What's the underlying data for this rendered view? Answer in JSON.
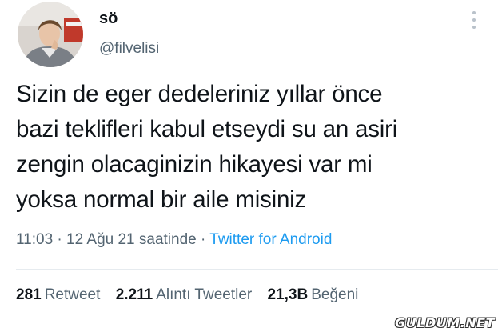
{
  "tweet": {
    "author": {
      "display_name": "sö",
      "handle": "@filvelisi",
      "avatar_icon": "profile-photo"
    },
    "more_icon": "more-vertical-icon",
    "text": "Sizin de eger dedeleriniz yıllar önce\nbazi teklifleri kabul etseydi su an asiri\nzengin olacaginizin hikayesi var mi\nyoksa normal bir aile misiniz",
    "time": "11:03",
    "separator": "·",
    "date": "12 Ağu 21 saatinde",
    "source": "Twitter for Android",
    "source_color": "#1d9bf0",
    "stats": {
      "retweets_count": "281",
      "retweets_label": "Retweet",
      "quotes_count": "2.211",
      "quotes_label": "Alıntı Tweetler",
      "likes_count": "21,3B",
      "likes_label": "Beğeni"
    }
  },
  "watermark": "GULDUM.NET"
}
